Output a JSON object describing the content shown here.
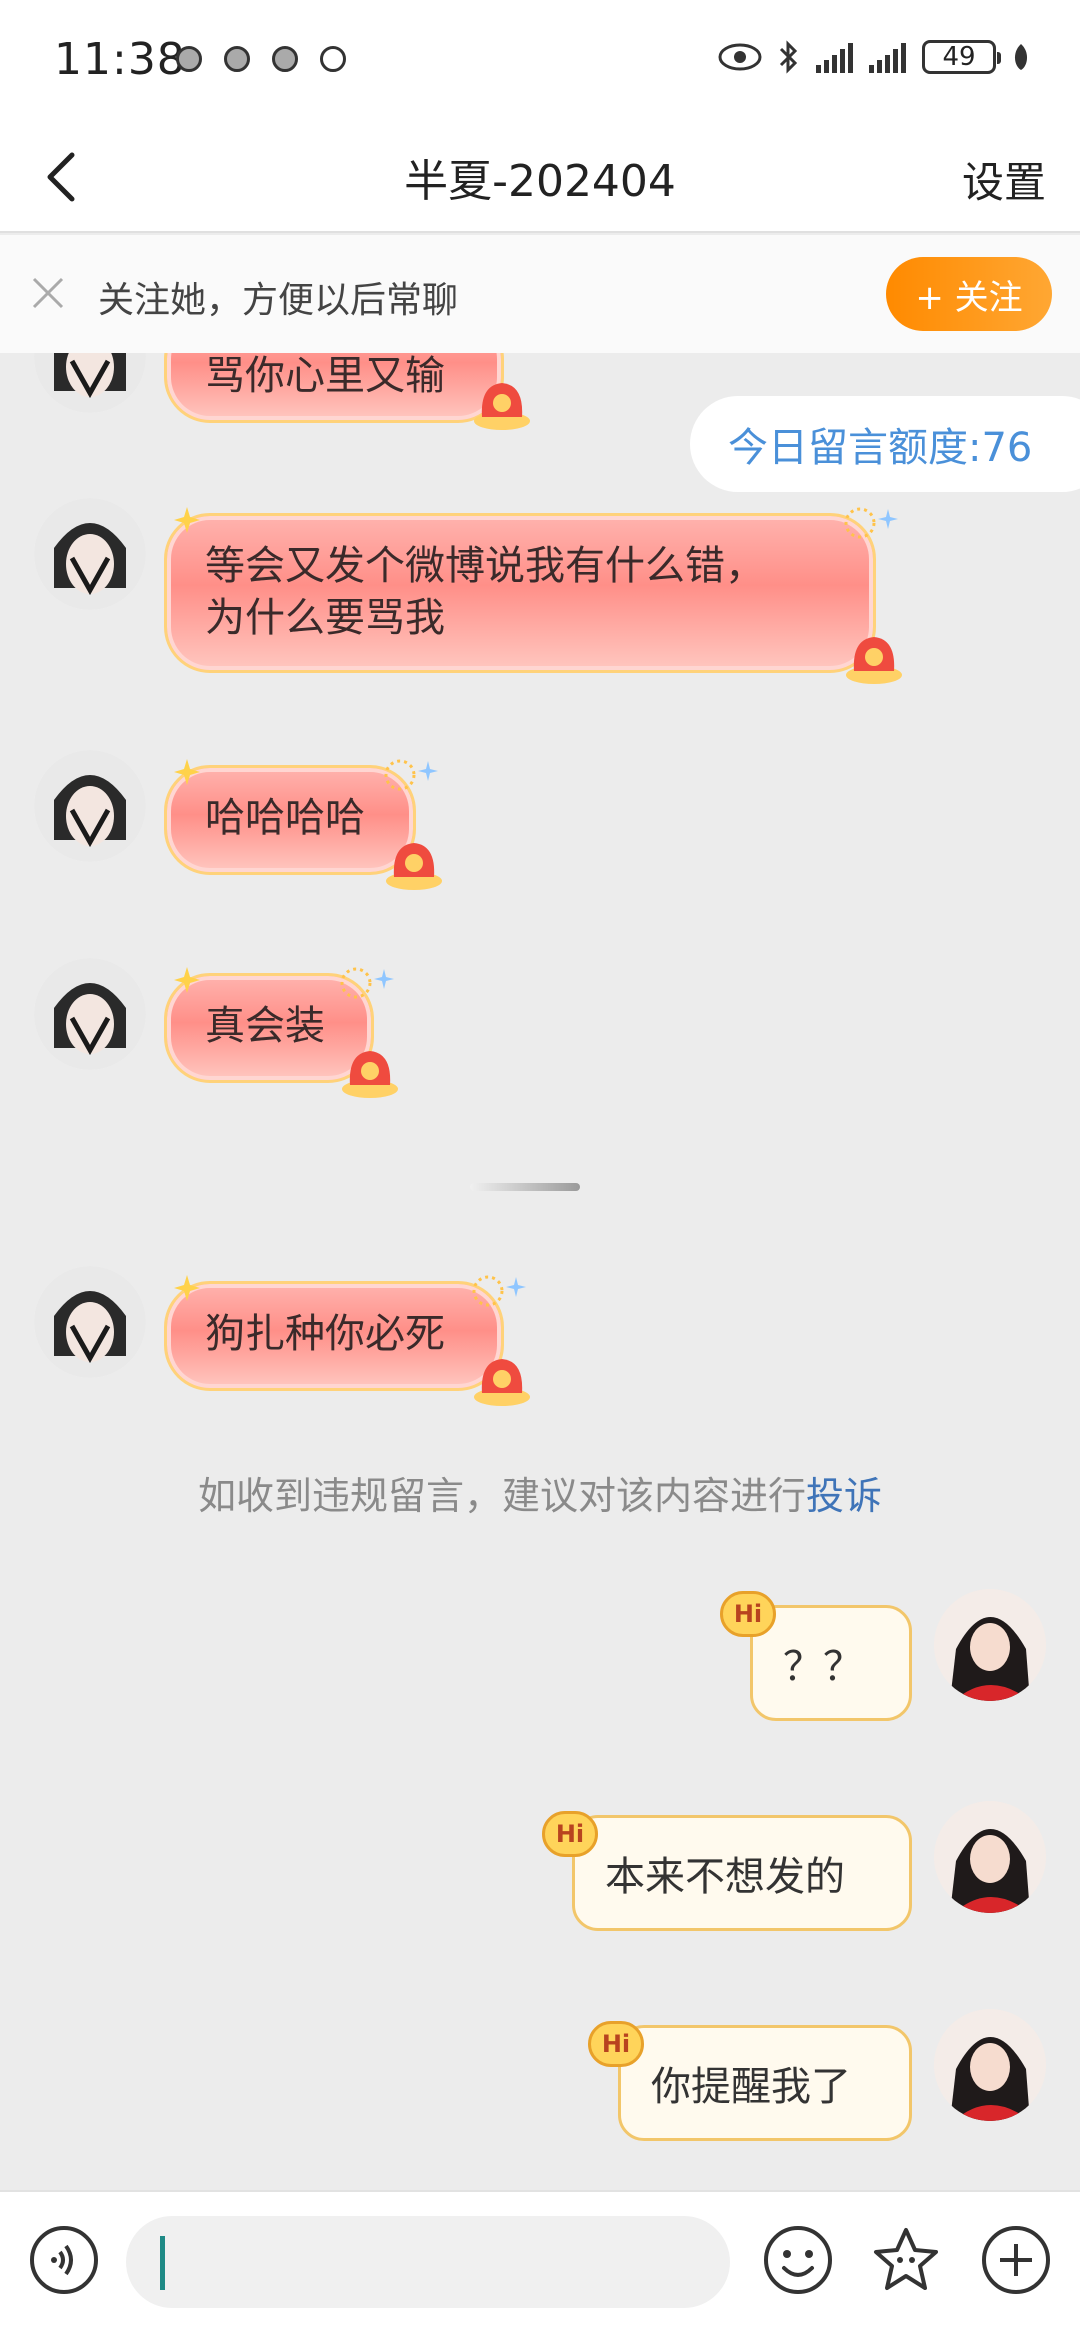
{
  "status_bar": {
    "time": "11:38",
    "battery": "49"
  },
  "nav": {
    "title": "半夏-202404",
    "settings_label": "设置"
  },
  "follow_bar": {
    "text": "关注她，方便以后常聊",
    "button_label": "+ 关注"
  },
  "chat": {
    "partial_message": "骂你心里又输",
    "quota_text": "今日留言额度:76",
    "incoming": [
      {
        "text_line1": "等会又发个微博说我有什么错，",
        "text_line2": "为什么要骂我"
      },
      {
        "text": "哈哈哈哈"
      },
      {
        "text": "真会装"
      },
      {
        "text": "狗扎种你必死"
      }
    ],
    "notice_text": "如收到违规留言，建议对该内容进行",
    "notice_link": "投诉",
    "outgoing": [
      {
        "text": "？？"
      },
      {
        "text": "本来不想发的"
      },
      {
        "text": "你提醒我了"
      }
    ],
    "hi_label": "Hi"
  },
  "input_bar": {
    "icons": [
      "voice-icon",
      "emoji-icon",
      "sticker-icon",
      "plus-icon"
    ]
  },
  "colors": {
    "accent_orange": "#ff8a00",
    "link_blue": "#3f74b8",
    "quota_blue": "#4a90d9"
  }
}
